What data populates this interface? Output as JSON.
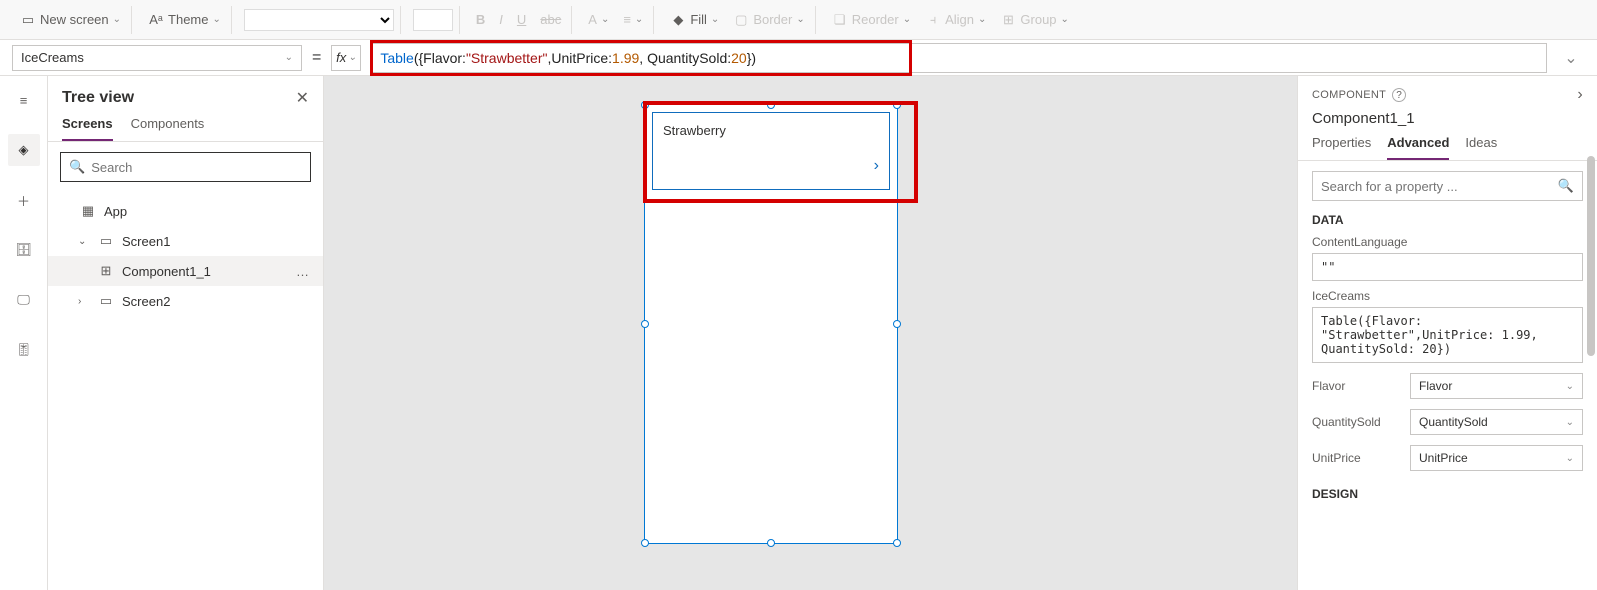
{
  "ribbon": {
    "new_screen": "New screen",
    "theme": "Theme",
    "fill": "Fill",
    "border": "Border",
    "reorder": "Reorder",
    "align": "Align",
    "group": "Group"
  },
  "formula": {
    "property": "IceCreams",
    "fx": "fx",
    "tokens": {
      "fn": "Table",
      "open": "({Flavor: ",
      "str": "\"Strawbetter\"",
      "mid1": ",UnitPrice: ",
      "num1": "1.99",
      "mid2": ", QuantitySold: ",
      "num2": "20",
      "close": "})"
    }
  },
  "tree": {
    "title": "Tree view",
    "tab_screens": "Screens",
    "tab_components": "Components",
    "search_placeholder": "Search",
    "app": "App",
    "screen1": "Screen1",
    "component": "Component1_1",
    "screen2": "Screen2"
  },
  "canvas": {
    "gallery_flavor": "Strawberry"
  },
  "right": {
    "header": "COMPONENT",
    "title": "Component1_1",
    "tab_properties": "Properties",
    "tab_advanced": "Advanced",
    "tab_ideas": "Ideas",
    "search_placeholder": "Search for a property ...",
    "section_data": "DATA",
    "contentlanguage_label": "ContentLanguage",
    "contentlanguage_value": "\"\"",
    "icecreams_label": "IceCreams",
    "icecreams_value": "Table({Flavor: \"Strawbetter\",UnitPrice: 1.99, QuantitySold: 20})",
    "flavor_label": "Flavor",
    "flavor_value": "Flavor",
    "quantitysold_label": "QuantitySold",
    "quantitysold_value": "QuantitySold",
    "unitprice_label": "UnitPrice",
    "unitprice_value": "UnitPrice",
    "section_design": "DESIGN"
  }
}
